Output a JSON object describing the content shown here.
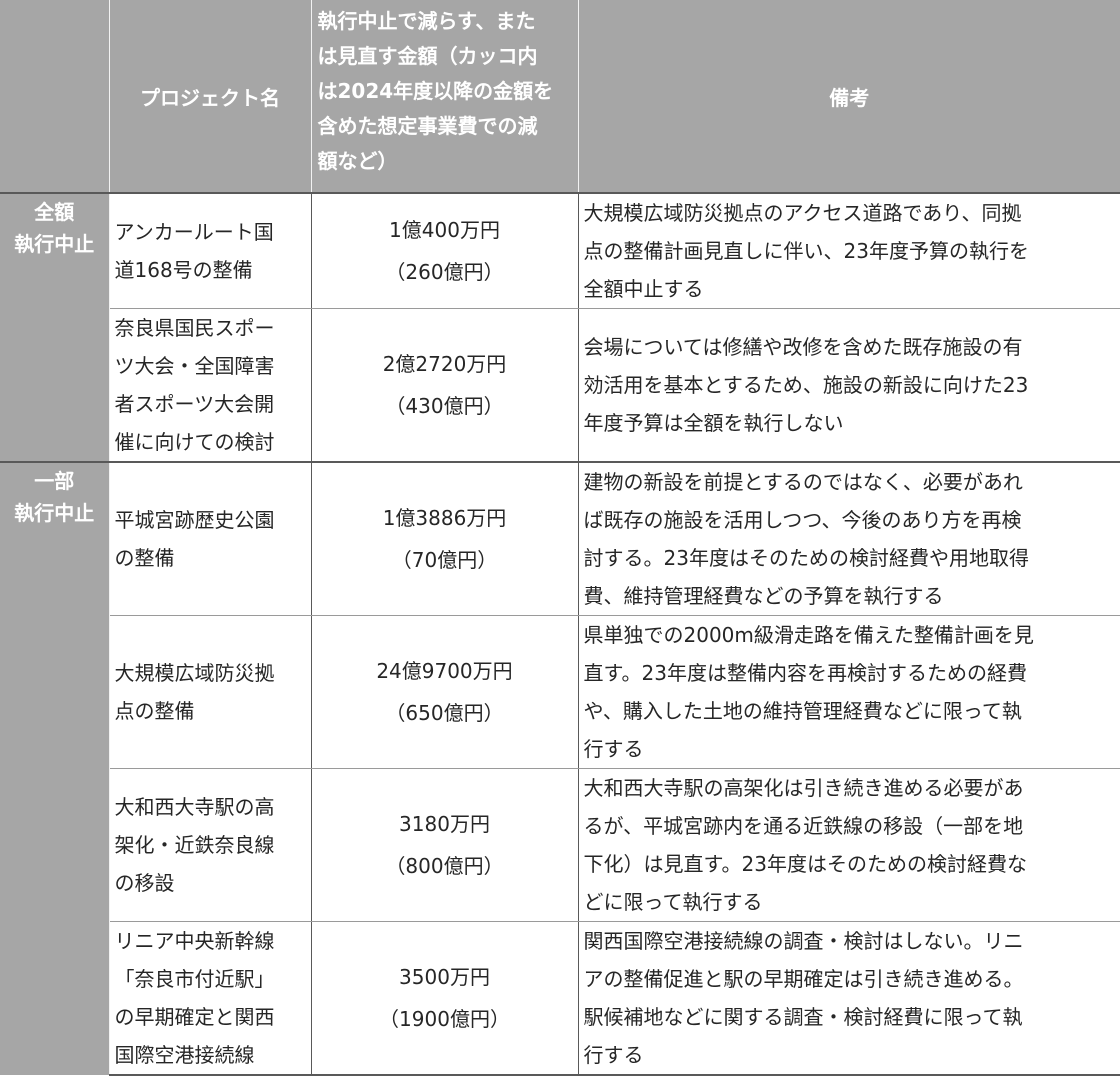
{
  "header": {
    "blank": "",
    "project_name": "プロジェクト名",
    "amount_lines": [
      "執行中止で減らす、また",
      "は見直す金額（カッコ内",
      "は2024年度以降の金額を",
      "含めた想定事業費での減",
      "額など）"
    ],
    "remarks": "備考"
  },
  "categories": [
    {
      "lines": [
        "全額",
        "執行中止"
      ]
    },
    {
      "lines": [
        "一部",
        "執行中止"
      ]
    }
  ],
  "rows": [
    {
      "project_lines": [
        "アンカールート国",
        "道168号の整備"
      ],
      "amount": "1億400万円",
      "amount_total": "（260億円）",
      "remark_lines": [
        "大規模広域防災拠点のアクセス道路であり、同拠",
        "点の整備計画見直しに伴い、23年度予算の執行を",
        "全額中止する"
      ]
    },
    {
      "project_lines": [
        "奈良県国民スポー",
        "ツ大会・全国障害",
        "者スポーツ大会開",
        "催に向けての検討"
      ],
      "amount": "2億2720万円",
      "amount_total": "（430億円）",
      "remark_lines": [
        "会場については修繕や改修を含めた既存施設の有",
        "効活用を基本とするため、施設の新設に向けた23",
        "年度予算は全額を執行しない"
      ]
    },
    {
      "project_lines": [
        "平城宮跡歴史公園",
        "の整備"
      ],
      "amount": "1億3886万円",
      "amount_total": "（70億円）",
      "remark_lines": [
        "建物の新設を前提とするのではなく、必要があれ",
        "ば既存の施設を活用しつつ、今後のあり方を再検",
        "討する。23年度はそのための検討経費や用地取得",
        "費、維持管理経費などの予算を執行する"
      ]
    },
    {
      "project_lines": [
        "大規模広域防災拠",
        "点の整備"
      ],
      "amount": "24億9700万円",
      "amount_total": "（650億円）",
      "remark_lines": [
        "県単独での2000m級滑走路を備えた整備計画を見",
        "直す。23年度は整備内容を再検討するための経費",
        "や、購入した土地の維持管理経費などに限って執",
        "行する"
      ]
    },
    {
      "project_lines": [
        "大和西大寺駅の高",
        "架化・近鉄奈良線",
        "の移設"
      ],
      "amount": "3180万円",
      "amount_total": "（800億円）",
      "remark_lines": [
        "大和西大寺駅の高架化は引き続き進める必要があ",
        "るが、平城宮跡内を通る近鉄線の移設（一部を地",
        "下化）は見直す。23年度はそのための検討経費な",
        "どに限って執行する"
      ]
    },
    {
      "project_lines": [
        "リニア中央新幹線",
        "「奈良市付近駅」",
        "の早期確定と関西",
        "国際空港接続線"
      ],
      "amount": "3500万円",
      "amount_total": "（1900億円）",
      "remark_lines": [
        "関西国際空港接続線の調査・検討はしない。リニ",
        "アの整備促進と駅の早期確定は引き続き進める。",
        "駅候補地などに関する調査・検討経費に限って執",
        "行する"
      ]
    }
  ]
}
